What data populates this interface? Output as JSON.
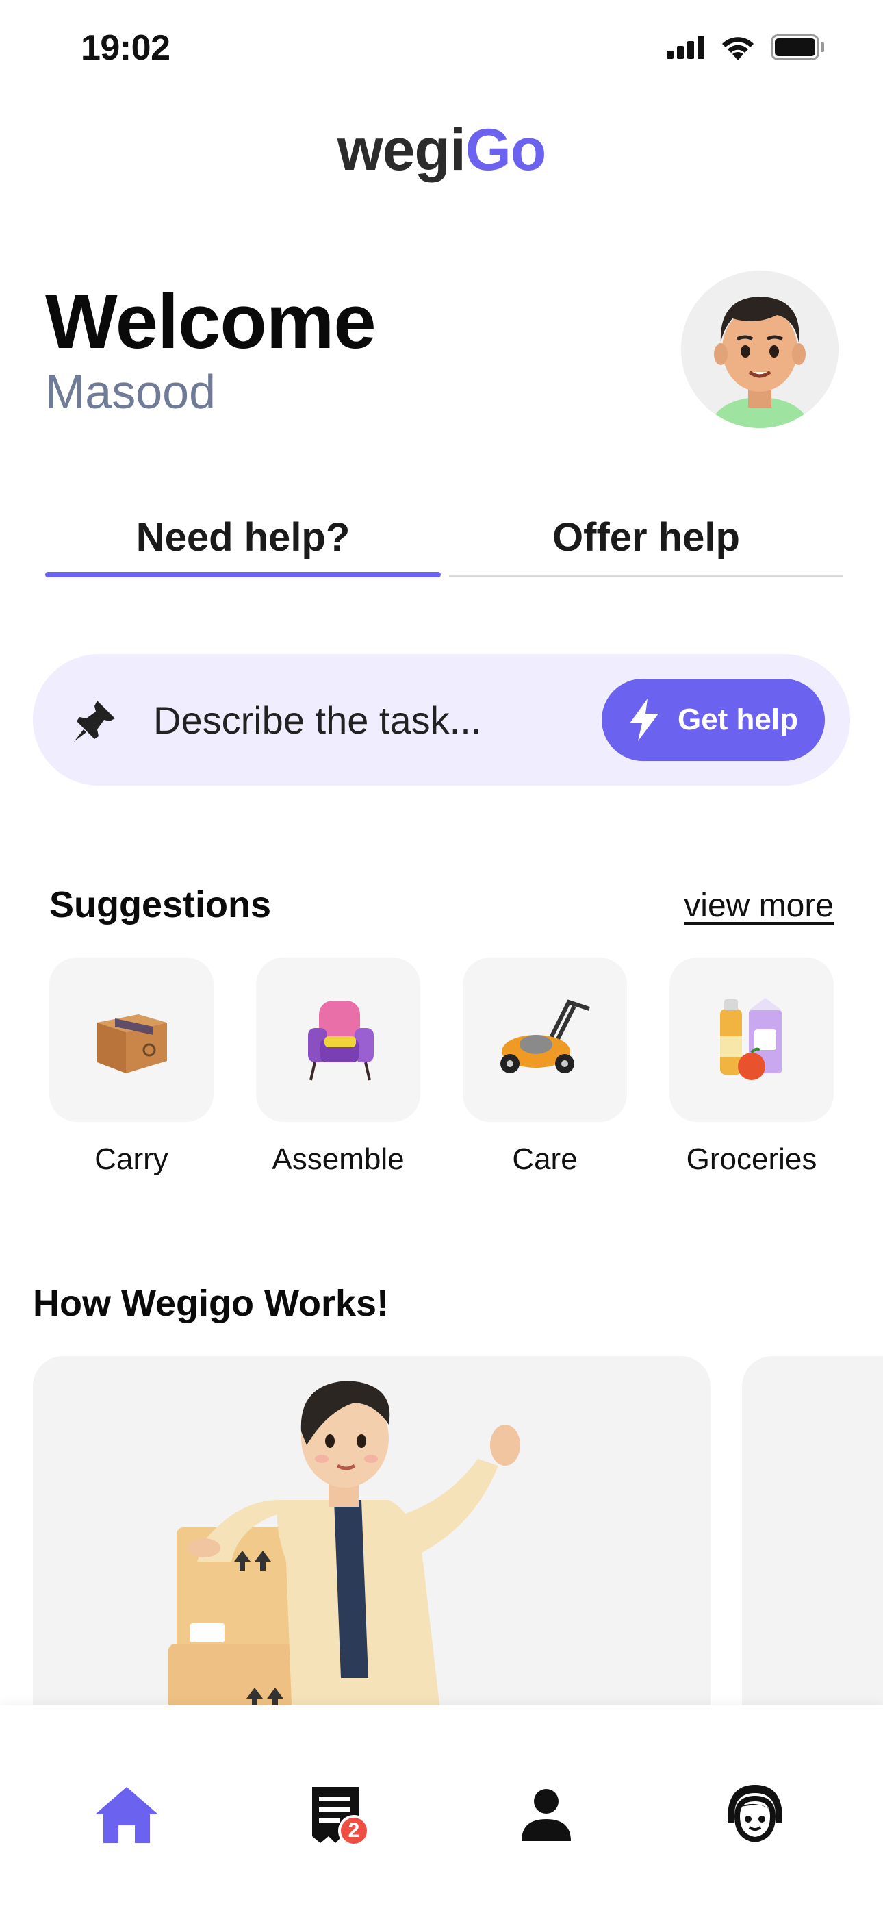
{
  "status_bar": {
    "time": "19:02"
  },
  "logo": {
    "part1": "wegi",
    "part2": "Go"
  },
  "welcome": {
    "title": "Welcome",
    "name": "Masood"
  },
  "tabs": [
    {
      "label": "Need help?",
      "active": true
    },
    {
      "label": "Offer help",
      "active": false
    }
  ],
  "task_bar": {
    "placeholder": "Describe the task...",
    "button_label": "Get help"
  },
  "suggestions": {
    "title": "Suggestions",
    "view_more": "view more",
    "items": [
      {
        "label": "Carry",
        "icon": "cardboard-box-icon"
      },
      {
        "label": "Assemble",
        "icon": "armchair-icon"
      },
      {
        "label": "Care",
        "icon": "lawn-mower-icon"
      },
      {
        "label": "Groceries",
        "icon": "groceries-icon"
      }
    ]
  },
  "how_it_works": {
    "title": "How Wegigo Works!"
  },
  "bottom_nav": {
    "items": [
      {
        "name": "home",
        "icon": "home-icon",
        "active": true
      },
      {
        "name": "orders",
        "icon": "receipt-icon",
        "badge": "2"
      },
      {
        "name": "profile",
        "icon": "person-icon"
      },
      {
        "name": "support",
        "icon": "support-agent-icon"
      }
    ]
  },
  "colors": {
    "accent": "#6b63f0",
    "accent_light": "#efedfe",
    "badge": "#ef4f43",
    "name_gray": "#6f7b97"
  }
}
